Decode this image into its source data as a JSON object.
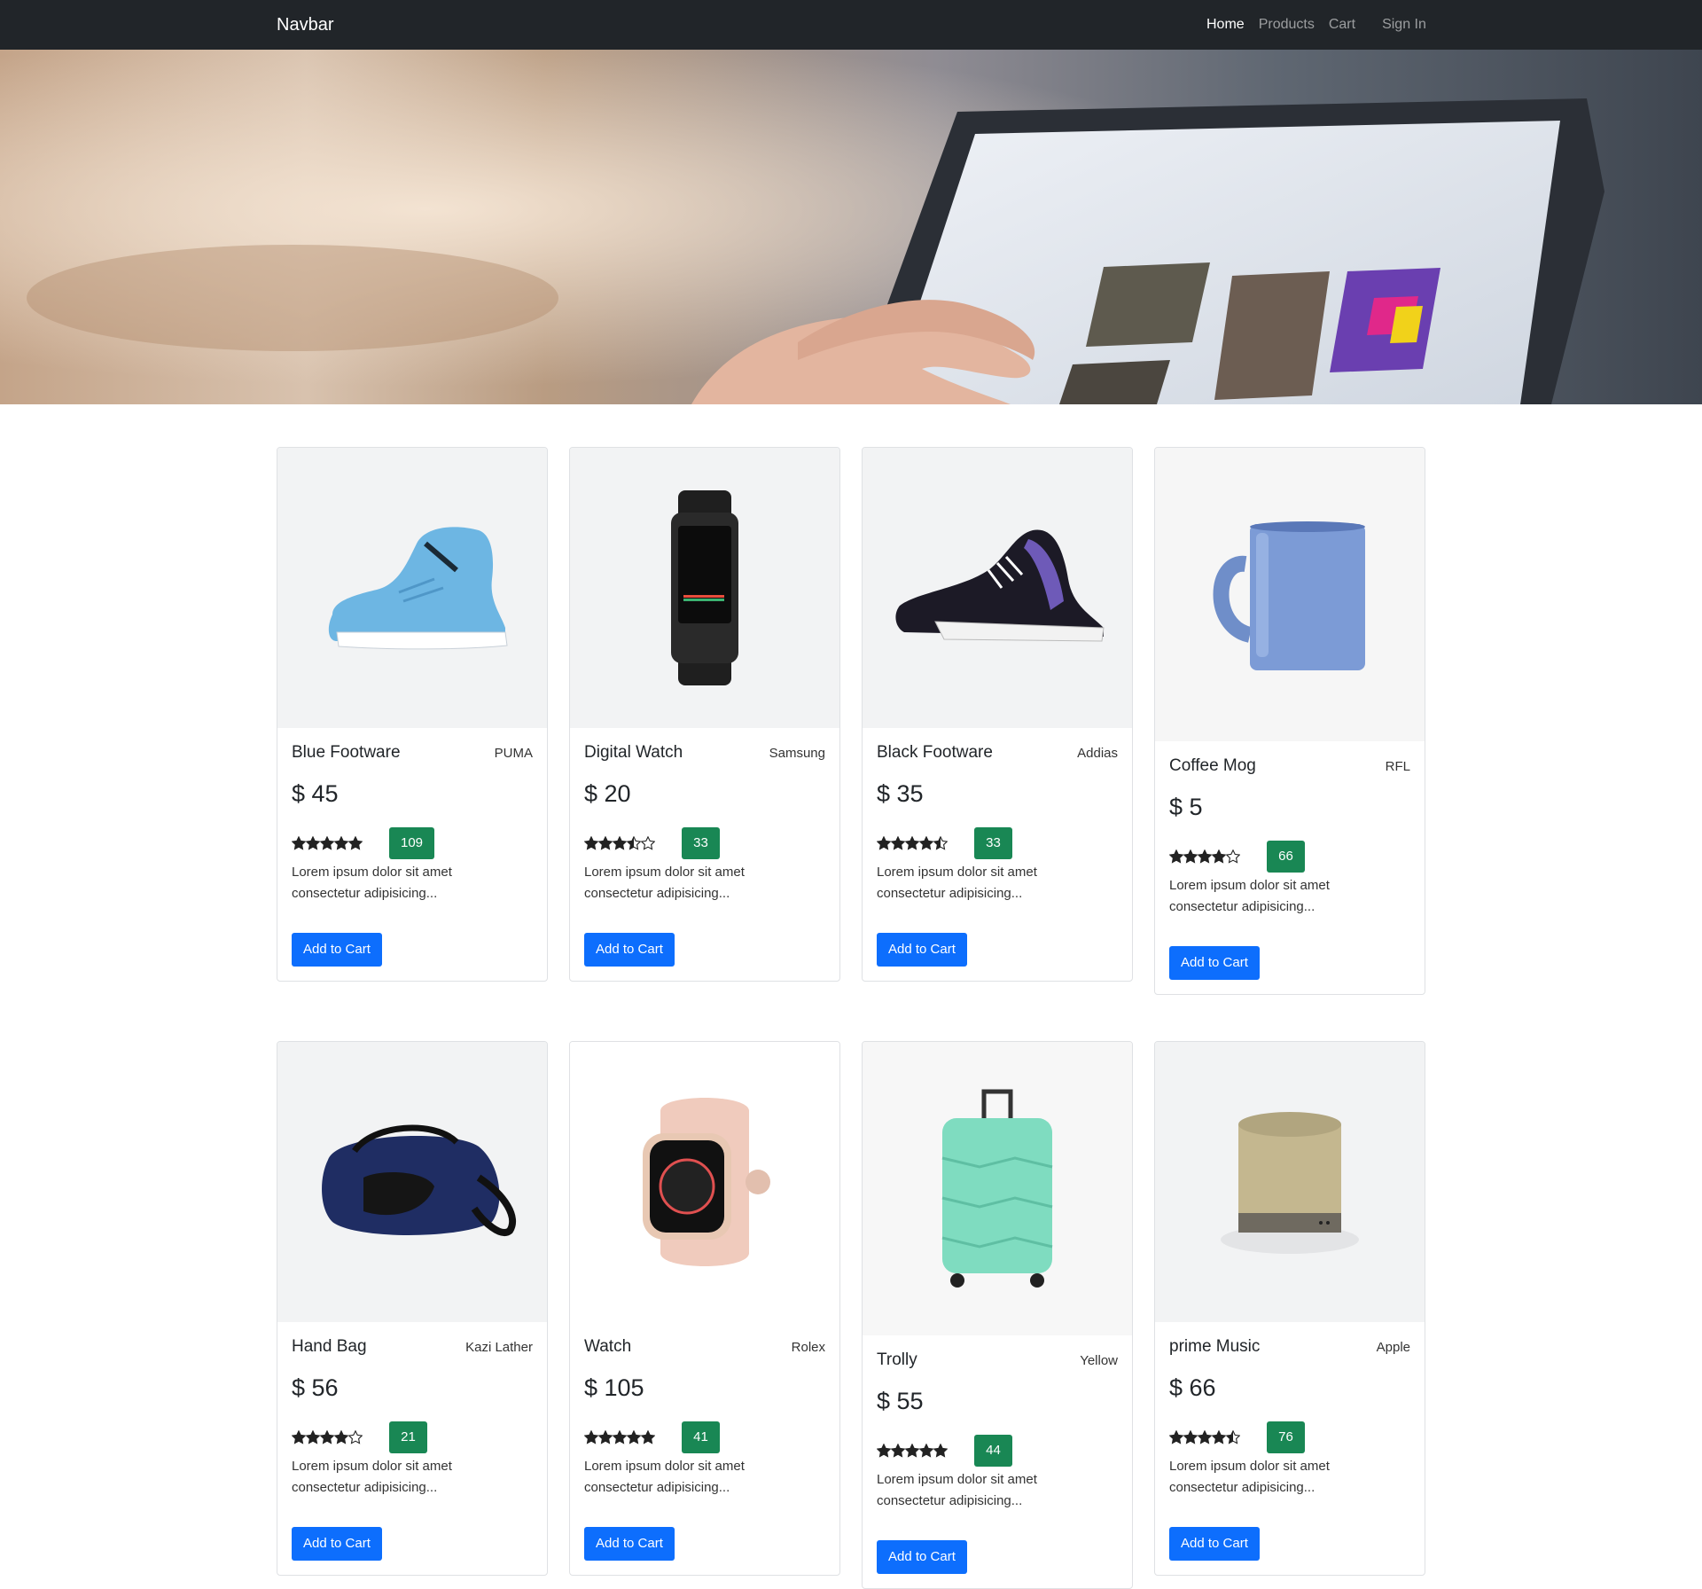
{
  "navbar": {
    "brand": "Navbar",
    "links": [
      {
        "label": "Home",
        "active": true
      },
      {
        "label": "Products",
        "active": false
      },
      {
        "label": "Cart",
        "active": false
      },
      {
        "label": "Sign In",
        "active": false
      }
    ]
  },
  "products": [
    {
      "title": "Blue Footware",
      "brand": "PUMA",
      "price": "$ 45",
      "rating": 5,
      "reviews": "109",
      "description": "Lorem ipsum dolor sit amet consectetur adipisicing...",
      "button": "Add to Cart",
      "image": "blue-sneaker"
    },
    {
      "title": "Digital Watch",
      "brand": "Samsung",
      "price": "$ 20",
      "rating": 3.5,
      "reviews": "33",
      "description": "Lorem ipsum dolor sit amet consectetur adipisicing...",
      "button": "Add to Cart",
      "image": "fitness-band"
    },
    {
      "title": "Black Footware",
      "brand": "Addias",
      "price": "$ 35",
      "rating": 4.5,
      "reviews": "33",
      "description": "Lorem ipsum dolor sit amet consectetur adipisicing...",
      "button": "Add to Cart",
      "image": "black-sneaker"
    },
    {
      "title": "Coffee Mog",
      "brand": "RFL",
      "price": "$ 5",
      "rating": 4,
      "reviews": "66",
      "description": "Lorem ipsum dolor sit amet consectetur adipisicing...",
      "button": "Add to Cart",
      "image": "blue-mug"
    },
    {
      "title": "Hand Bag",
      "brand": "Kazi Lather",
      "price": "$ 56",
      "rating": 4,
      "reviews": "21",
      "description": "Lorem ipsum dolor sit amet consectetur adipisicing...",
      "button": "Add to Cart",
      "image": "duffel-bag"
    },
    {
      "title": "Watch",
      "brand": "Rolex",
      "price": "$ 105",
      "rating": 5,
      "reviews": "41",
      "description": "Lorem ipsum dolor sit amet consectetur adipisicing...",
      "button": "Add to Cart",
      "image": "smart-watch"
    },
    {
      "title": "Trolly",
      "brand": "Yellow",
      "price": "$ 55",
      "rating": 5,
      "reviews": "44",
      "description": "Lorem ipsum dolor sit amet consectetur adipisicing...",
      "button": "Add to Cart",
      "image": "suitcase"
    },
    {
      "title": "prime Music",
      "brand": "Apple",
      "price": "$ 66",
      "rating": 4.5,
      "reviews": "76",
      "description": "Lorem ipsum dolor sit amet consectetur adipisicing...",
      "button": "Add to Cart",
      "image": "speaker"
    }
  ],
  "colors": {
    "navbar_bg": "#212529",
    "primary_button": "#0d6efd",
    "badge_green": "#198754",
    "card_image_bg": "#f2f3f4"
  }
}
